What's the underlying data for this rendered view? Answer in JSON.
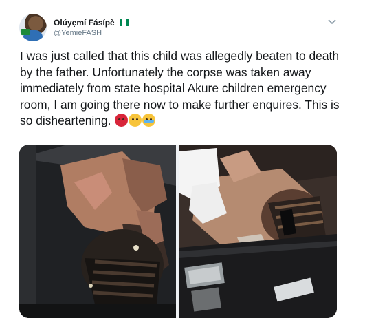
{
  "user": {
    "display_name": "Olúyẹmí Fásípè",
    "handle": "@YemieFASH",
    "flag": "nigeria-flag"
  },
  "tweet": {
    "text": "I was just called that this child was allegedly beaten to death by the father. Unfortunately the corpse was taken away immediately from state hospital Akure children emergency room, I am going there now to make further enquires. This is so disheartening.",
    "emojis": [
      "angry-face",
      "frowning-face",
      "crying-face"
    ]
  },
  "media": {
    "photo_count": 2
  },
  "colors": {
    "text": "#14171a",
    "secondary_text": "#657786",
    "nigeria_green": "#008751"
  }
}
